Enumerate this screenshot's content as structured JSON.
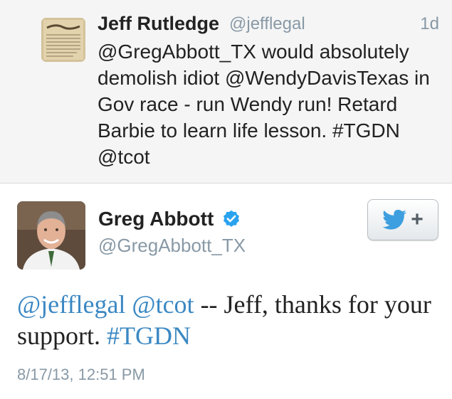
{
  "reply_tweet": {
    "author_name": "Jeff Rutledge",
    "author_handle": "@jefflegal",
    "time_ago": "1d",
    "text_lines": [
      "@GregAbbott_TX would absolutely",
      "demolish idiot @WendyDavisTexas in",
      "Gov race - run Wendy run! Retard",
      "Barbie to learn life lesson. #TGDN",
      "@tcot"
    ]
  },
  "main_tweet": {
    "author_name": "Greg Abbott",
    "author_handle": "@GregAbbott_TX",
    "verified": true,
    "follow_button": {
      "icon": "twitter-bird-icon",
      "symbol": "+"
    },
    "text_segments": [
      {
        "text": "@jefflegal",
        "link": true
      },
      {
        "text": " ",
        "link": false
      },
      {
        "text": "@tcot",
        "link": true
      },
      {
        "text": " -- Jeff, thanks for your support. ",
        "link": false
      },
      {
        "text": "#TGDN",
        "link": true
      }
    ],
    "timestamp": "8/17/13, 12:51 PM"
  },
  "colors": {
    "link": "#3b88c3",
    "verified_badge": "#2aa3ef",
    "twitter_bird": "#3d9ee0",
    "meta_gray": "#8899a6"
  }
}
